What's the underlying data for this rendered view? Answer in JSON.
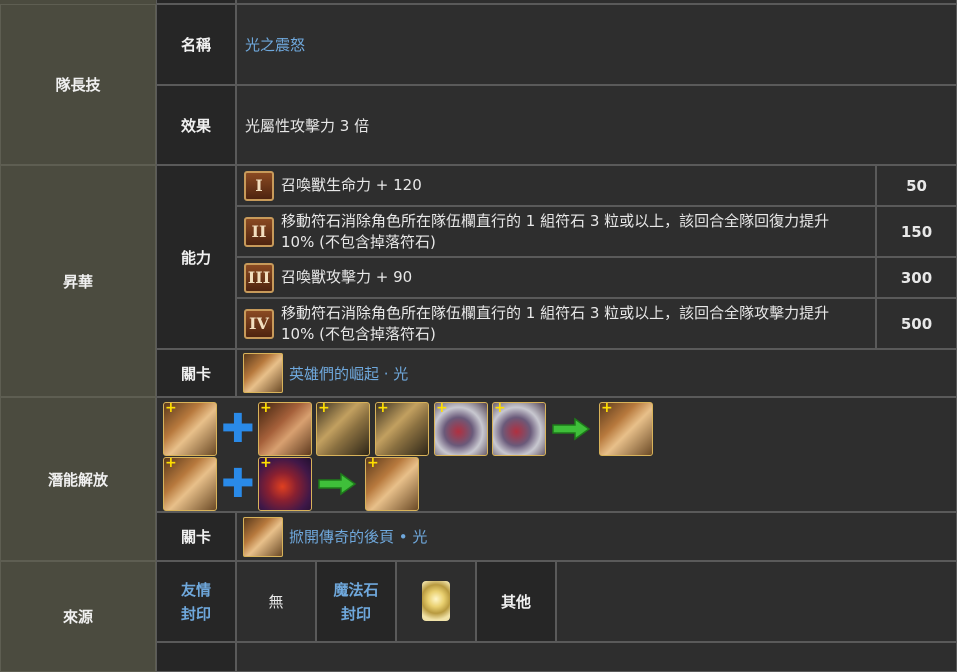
{
  "sections": {
    "leader_skill": "隊長技",
    "ascension": "昇華",
    "potential": "潛能解放",
    "source": "來源"
  },
  "leader": {
    "name_label": "名稱",
    "name_value": "光之震怒",
    "effect_label": "效果",
    "effect_value": "光屬性攻擊力 3 倍"
  },
  "ascension": {
    "ability_label": "能力",
    "abilities": [
      {
        "numeral": "I",
        "text": "召喚獸生命力 + 120",
        "cost": "50"
      },
      {
        "numeral": "II",
        "text": "移動符石消除角色所在隊伍欄直行的 1 組符石 3 粒或以上，該回合全隊回復力提升 10% (不包含掉落符石)",
        "cost": "150"
      },
      {
        "numeral": "III",
        "text": "召喚獸攻擊力 + 90",
        "cost": "300"
      },
      {
        "numeral": "IV",
        "text": "移動符石消除角色所在隊伍欄直行的 1 組符石 3 粒或以上，該回合全隊攻擊力提升 10% (不包含掉落符石)",
        "cost": "500"
      }
    ],
    "stage_label": "關卡",
    "stage_value": "英雄們的崛起 · 光"
  },
  "potential": {
    "stage_label": "關卡",
    "stage_value": "掀開傳奇的後頁 • 光",
    "plus_symbol": "+"
  },
  "source": {
    "friend_seal": "友情\n封印",
    "none": "無",
    "magic_stone_seal": "魔法石\n封印",
    "other": "其他"
  },
  "colors": {
    "link": "#6fa8dc",
    "category_bg": "#4b4b3f",
    "plus_blue": "#2a8ae8",
    "arrow_green": "#3fbf3a"
  }
}
